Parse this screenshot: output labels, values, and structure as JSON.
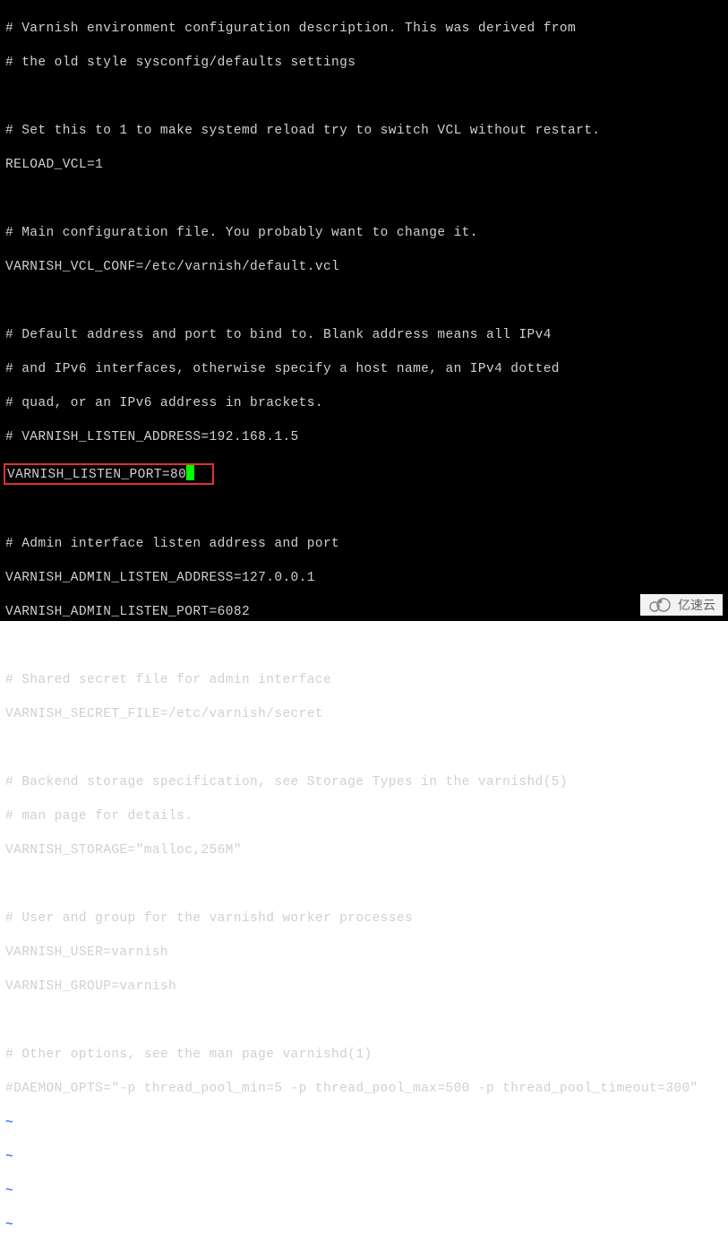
{
  "config": {
    "comments": {
      "header1": "# Varnish environment configuration description. This was derived from",
      "header2": "# the old style sysconfig/defaults settings",
      "reload": "# Set this to 1 to make systemd reload try to switch VCL without restart.",
      "main_conf": "# Main configuration file. You probably want to change it.",
      "default1": "# Default address and port to bind to. Blank address means all IPv4",
      "default2": "# and IPv6 interfaces, otherwise specify a host name, an IPv4 dotted",
      "default3": "# quad, or an IPv6 address in brackets.",
      "listen_addr": "# VARNISH_LISTEN_ADDRESS=192.168.1.5",
      "admin": "# Admin interface listen address and port",
      "secret": "# Shared secret file for admin interface",
      "storage1": "# Backend storage specification, see Storage Types in the varnishd(5)",
      "storage2": "# man page for details.",
      "user_group": "# User and group for the varnishd worker processes",
      "other": "# Other options, see the man page varnishd(1)"
    },
    "settings": {
      "reload_vcl": "RELOAD_VCL=1",
      "vcl_conf": "VARNISH_VCL_CONF=/etc/varnish/default.vcl",
      "listen_port": "VARNISH_LISTEN_PORT=80",
      "admin_addr": "VARNISH_ADMIN_LISTEN_ADDRESS=127.0.0.1",
      "admin_port": "VARNISH_ADMIN_LISTEN_PORT=6082",
      "secret_file": "VARNISH_SECRET_FILE=/etc/varnish/secret",
      "storage": "VARNISH_STORAGE=\"malloc,256M\"",
      "user": "VARNISH_USER=varnish",
      "group": "VARNISH_GROUP=varnish",
      "daemon_opts": "#DAEMON_OPTS=\"-p thread_pool_min=5 -p thread_pool_max=500 -p thread_pool_timeout=300\""
    },
    "tilde": "~"
  },
  "watermark": {
    "text": "亿速云"
  }
}
